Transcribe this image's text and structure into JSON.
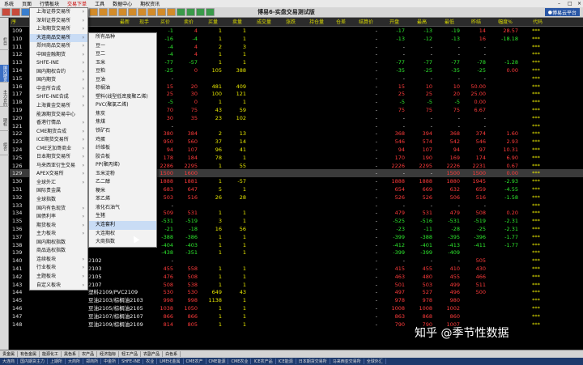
{
  "menubar": {
    "items": [
      "系统",
      "页面",
      "行情板块",
      "交易下单",
      "工具",
      "数据中心",
      "期权资讯"
    ],
    "active_index": 3
  },
  "titlebar": {
    "app_title": "博易6-实盘交易测试版",
    "user": "博易云平台"
  },
  "toolbar": {
    "button_colors": [
      "#c94a3b",
      "#c94a3b",
      "#3a7fcf",
      "#3a7fcf",
      "#3a7fcf",
      "#7a7a7a",
      "#7a7a7a",
      "#d28b2a",
      "#d28b2a",
      "#d28b2a",
      "#d28b2a",
      "#d28b2a",
      "#d28b2a",
      "#d28b2a",
      "#d28b2a",
      "#d28b2a",
      "#d28b2a",
      "#d28b2a",
      "#3a9a4a",
      "#3a9a4a",
      "#3a9a4a",
      "#3a9a4a"
    ]
  },
  "sidebar": {
    "tabs": [
      "栏目",
      "国内期货",
      "主力合约",
      "期权",
      "组合"
    ],
    "active_index": 1
  },
  "table": {
    "columns": [
      "序",
      "代码",
      "名称",
      "最新",
      "现手",
      "买价",
      "卖价",
      "买量",
      "卖量",
      "成交量",
      "涨跌",
      "持仓量",
      "仓差",
      "结算价",
      "开盘",
      "最高",
      "最低",
      "昨结",
      "幅度%",
      "代码"
    ],
    "rows": [
      {
        "no": "109",
        "name": "",
        "c5": "-1",
        "c6": "4",
        "c7": "1",
        "c8": "1",
        "c13": "-",
        "c14": "-17",
        "c15": "-13",
        "c16": "-19",
        "c17": "14",
        "c18": "28.57",
        "code": "***"
      },
      {
        "no": "110",
        "name": "",
        "c5": "-16",
        "c6": "-4",
        "c7": "1",
        "c8": "1",
        "c13": "-",
        "c14": "-13",
        "c15": "-12",
        "c16": "-13",
        "c17": "16",
        "c18": "-18.18",
        "code": "***"
      },
      {
        "no": "111",
        "name": "",
        "c5": "-4",
        "c6": "4",
        "c7": "2",
        "c8": "3",
        "c13": "-",
        "c14": "-",
        "c15": "-",
        "c16": "-",
        "c17": "-",
        "c18": "",
        "code": "***"
      },
      {
        "no": "112",
        "name": "",
        "c5": "-4",
        "c6": "4",
        "c7": "1",
        "c8": "1",
        "c13": "-",
        "c14": "-",
        "c15": "-",
        "c16": "-",
        "c17": "-",
        "c18": "",
        "code": "***"
      },
      {
        "no": "113",
        "name": "",
        "c5": "-77",
        "c6": "-57",
        "c7": "1",
        "c8": "1",
        "c13": "-",
        "c14": "-77",
        "c15": "-77",
        "c16": "-77",
        "c17": "-78",
        "c18": "-1.28",
        "code": "***"
      },
      {
        "no": "114",
        "name": "",
        "c5": "-25",
        "c6": "0",
        "c7": "105",
        "c8": "388",
        "c13": "-",
        "c14": "-35",
        "c15": "-25",
        "c16": "-35",
        "c17": "-25",
        "c18": "0.00",
        "code": "***"
      },
      {
        "no": "115",
        "name": "",
        "c5": "-",
        "c6": "",
        "c7": "",
        "c8": "",
        "c13": "-",
        "c14": "-",
        "c15": "-",
        "c16": "-",
        "c17": "-",
        "c18": "",
        "code": "***"
      },
      {
        "no": "116",
        "name": "",
        "c5": "15",
        "c6": "20",
        "c7": "481",
        "c8": "409",
        "c13": "-",
        "c14": "15",
        "c15": "10",
        "c16": "10",
        "c17": "50.00",
        "c18": "",
        "code": "***"
      },
      {
        "no": "117",
        "name": "",
        "c5": "25",
        "c6": "30",
        "c7": "100",
        "c8": "121",
        "c13": "-",
        "c14": "25",
        "c15": "25",
        "c16": "20",
        "c17": "25.00",
        "c18": "",
        "code": "***"
      },
      {
        "no": "118",
        "name": "",
        "c5": "-5",
        "c6": "0",
        "c7": "1",
        "c8": "1",
        "c13": "-",
        "c14": "-5",
        "c15": "-5",
        "c16": "-5",
        "c17": "0.00",
        "c18": "",
        "code": "***"
      },
      {
        "no": "119",
        "name": "",
        "c5": "70",
        "c6": "75",
        "c7": "43",
        "c8": "59",
        "c13": "-",
        "c14": "75",
        "c15": "75",
        "c16": "75",
        "c17": "6.67",
        "c18": "",
        "code": "***"
      },
      {
        "no": "120",
        "name": "",
        "c5": "30",
        "c6": "35",
        "c7": "23",
        "c8": "102",
        "c13": "-",
        "c14": "-",
        "c15": "-",
        "c16": "-",
        "c17": "-",
        "c18": "",
        "code": "***"
      },
      {
        "no": "121",
        "name": "",
        "c5": "-",
        "c6": "",
        "c7": "",
        "c8": "",
        "c13": "-",
        "c14": "-",
        "c15": "-",
        "c16": "-",
        "c17": "-",
        "c18": "",
        "code": "***"
      },
      {
        "no": "122",
        "name": "",
        "c5": "380",
        "c6": "384",
        "c7": "2",
        "c8": "13",
        "c13": "-",
        "c14": "368",
        "c15": "394",
        "c16": "368",
        "c17": "374",
        "c18": "1.60",
        "code": "***"
      },
      {
        "no": "123",
        "name": "",
        "c5": "950",
        "c6": "560",
        "c7": "37",
        "c8": "14",
        "c13": "-",
        "c14": "546",
        "c15": "574",
        "c16": "542",
        "c17": "546",
        "c18": "2.93",
        "code": "***"
      },
      {
        "no": "124",
        "name": "",
        "c5": "94",
        "c6": "107",
        "c7": "96",
        "c8": "41",
        "c13": "-",
        "c14": "94",
        "c15": "107",
        "c16": "94",
        "c17": "97",
        "c18": "10.31",
        "code": "***"
      },
      {
        "no": "125",
        "name": "",
        "c5": "178",
        "c6": "184",
        "c7": "78",
        "c8": "1",
        "c13": "-",
        "c14": "170",
        "c15": "190",
        "c16": "169",
        "c17": "174",
        "c18": "6.90",
        "code": "***"
      },
      {
        "no": "126",
        "name": "",
        "c5": "2286",
        "c6": "2295",
        "c7": "1",
        "c8": "55",
        "c13": "-",
        "c14": "2226",
        "c15": "2295",
        "c16": "2226",
        "c17": "2231",
        "c18": "0.67",
        "code": "***"
      },
      {
        "no": "129",
        "name": "",
        "c5": "1500",
        "c6": "1600",
        "c7": "",
        "c8": "",
        "c13": "-",
        "c14": "-",
        "c15": "-",
        "c16": "1500",
        "c17": "1500",
        "c18": "0.00",
        "code": "***"
      },
      {
        "no": "130",
        "name": "",
        "c5": "1888",
        "c6": "1881",
        "c7": "1",
        "c8": "-57",
        "c13": "-",
        "c14": "1888",
        "c15": "1888",
        "c16": "1880",
        "c17": "1945",
        "c18": "-2.93",
        "code": "***"
      },
      {
        "no": "131",
        "name": "",
        "c5": "683",
        "c6": "647",
        "c7": "5",
        "c8": "1",
        "c13": "-",
        "c14": "654",
        "c15": "669",
        "c16": "632",
        "c17": "659",
        "c18": "-4.55",
        "code": "***"
      },
      {
        "no": "132",
        "name": "",
        "c5": "503",
        "c6": "516",
        "c7": "26",
        "c8": "28",
        "c13": "-",
        "c14": "526",
        "c15": "526",
        "c16": "506",
        "c17": "516",
        "c18": "-1.58",
        "code": "***"
      },
      {
        "no": "133",
        "name": "",
        "c5": "-",
        "c6": "",
        "c7": "",
        "c8": "",
        "c13": "-",
        "c14": "-",
        "c15": "-",
        "c16": "-",
        "c17": "-",
        "c18": "",
        "code": "***"
      },
      {
        "no": "134",
        "name": "",
        "c5": "509",
        "c6": "531",
        "c7": "1",
        "c8": "1",
        "c13": "-",
        "c14": "479",
        "c15": "531",
        "c16": "479",
        "c17": "508",
        "c18": "0.20",
        "code": "***"
      },
      {
        "no": "135",
        "name": "",
        "c5": "-531",
        "c6": "-519",
        "c7": "3",
        "c8": "1",
        "c13": "-",
        "c14": "-525",
        "c15": "-516",
        "c16": "-531",
        "c17": "-519",
        "c18": "-2.31",
        "code": "***"
      },
      {
        "no": "136",
        "name": "",
        "c5": "-21",
        "c6": "-18",
        "c7": "16",
        "c8": "56",
        "c13": "-",
        "c14": "-23",
        "c15": "-11",
        "c16": "-28",
        "c17": "-25",
        "c18": "-2.31",
        "code": "***"
      },
      {
        "no": "137",
        "name": "",
        "c5": "-388",
        "c6": "-386",
        "c7": "1",
        "c8": "1",
        "c13": "-",
        "c14": "-399",
        "c15": "-388",
        "c16": "-395",
        "c17": "-396",
        "c18": "-1.77",
        "code": "***"
      },
      {
        "no": "138",
        "name": "",
        "c5": "-404",
        "c6": "-403",
        "c7": "1",
        "c8": "1",
        "c13": "-",
        "c14": "-412",
        "c15": "-401",
        "c16": "-413",
        "c17": "-411",
        "c18": "-1.77",
        "code": "***"
      },
      {
        "no": "139",
        "name": "",
        "c5": "-438",
        "c6": "-351",
        "c7": "1",
        "c8": "1",
        "c13": "-",
        "c14": "-399",
        "c15": "-399",
        "c16": "-409",
        "c17": "",
        "c18": "",
        "code": "***"
      },
      {
        "no": "140",
        "name": "2102",
        "c5": "-",
        "c6": "",
        "c7": "",
        "c8": "",
        "c13": "-",
        "c14": "-",
        "c15": "-",
        "c16": "-",
        "c17": "505",
        "c18": "",
        "code": "***"
      },
      {
        "no": "141",
        "name": "2103",
        "c5": "455",
        "c6": "558",
        "c7": "1",
        "c8": "1",
        "c13": "-",
        "c14": "415",
        "c15": "455",
        "c16": "410",
        "c17": "430",
        "c18": "",
        "code": "***"
      },
      {
        "no": "142",
        "name": "2105",
        "c5": "476",
        "c6": "508",
        "c7": "1",
        "c8": "1",
        "c13": "-",
        "c14": "463",
        "c15": "480",
        "c16": "455",
        "c17": "466",
        "c18": "",
        "code": "***"
      },
      {
        "no": "143",
        "name": "2107",
        "c5": "508",
        "c6": "538",
        "c7": "1",
        "c8": "1",
        "c13": "-",
        "c14": "501",
        "c15": "503",
        "c16": "499",
        "c17": "511",
        "c18": "",
        "code": "***"
      },
      {
        "no": "144",
        "name": "塑料2109/PVC2109",
        "c5": "530",
        "c6": "530",
        "c7": "649",
        "c8": "43",
        "c13": "-",
        "c14": "497",
        "c15": "527",
        "c16": "496",
        "c17": "500",
        "c18": "",
        "code": "***"
      },
      {
        "no": "145",
        "name": "豆油2103/棕榈油2103",
        "c5": "998",
        "c6": "998",
        "c7": "1138",
        "c8": "1",
        "c13": "-",
        "c14": "978",
        "c15": "978",
        "c16": "980",
        "c17": "",
        "c18": "",
        "code": "***"
      },
      {
        "no": "146",
        "name": "豆油2105/棕榈油2105",
        "c5": "1038",
        "c6": "1050",
        "c7": "1",
        "c8": "1",
        "c13": "-",
        "c14": "1008",
        "c15": "1008",
        "c16": "1002",
        "c17": "",
        "c18": "",
        "code": "***"
      },
      {
        "no": "147",
        "name": "豆油2107/棕榈油2107",
        "c5": "866",
        "c6": "866",
        "c7": "1",
        "c8": "1",
        "c13": "-",
        "c14": "863",
        "c15": "868",
        "c16": "860",
        "c17": "",
        "c18": "",
        "code": "***"
      },
      {
        "no": "148",
        "name": "豆油2109/棕榈油2109",
        "c5": "814",
        "c6": "805",
        "c7": "1",
        "c8": "1",
        "c13": "-",
        "c14": "790",
        "c15": "790",
        "c16": "1007",
        "c17": "",
        "c18": "",
        "code": "***"
      }
    ]
  },
  "menu1": {
    "items": [
      {
        "label": "上海证券交易所",
        "arrow": true
      },
      {
        "label": "深圳证券交易所",
        "arrow": true
      },
      {
        "label": "上海期货交易所",
        "arrow": true
      },
      {
        "label": "大连商品交易所",
        "arrow": true,
        "hl": true
      },
      {
        "label": "郑州商品交易所",
        "arrow": true
      },
      {
        "label": "中国金融期货",
        "arrow": true
      },
      {
        "label": "SHFE-INE",
        "arrow": true
      },
      {
        "label": "国内期权合约",
        "arrow": true
      },
      {
        "label": "国内期货",
        "arrow": true
      },
      {
        "label": "中金所合成",
        "arrow": true
      },
      {
        "label": "SHFE-INE合成",
        "arrow": true
      },
      {
        "label": "上海黄金交易所",
        "arrow": true
      },
      {
        "label": "能源期货交易中心",
        "arrow": false
      },
      {
        "label": "香港行情品",
        "arrow": true
      },
      {
        "label": "CME期货合成",
        "arrow": true
      },
      {
        "label": "ICE期货交易所",
        "arrow": true
      },
      {
        "label": "CME芝加哥商业",
        "arrow": true
      },
      {
        "label": "日本期货交易所",
        "arrow": true
      },
      {
        "label": "马来西亚衍生交易",
        "arrow": true
      },
      {
        "label": "APEX交易所",
        "arrow": true
      },
      {
        "label": "全球外汇",
        "arrow": true
      },
      {
        "label": "国际贵金属",
        "arrow": false
      },
      {
        "label": "全球指数",
        "arrow": false
      },
      {
        "label": "国内有色现货",
        "arrow": true
      },
      {
        "label": "国债利率",
        "arrow": true
      },
      {
        "label": "期货板块",
        "arrow": true
      },
      {
        "label": "主力板块",
        "arrow": true
      },
      {
        "label": "国内期权指数",
        "arrow": false
      },
      {
        "label": "商品选权指数",
        "arrow": false
      },
      {
        "label": "连续板块",
        "arrow": true
      },
      {
        "label": "行业板块",
        "arrow": true
      },
      {
        "label": "主题板块",
        "arrow": true
      },
      {
        "label": "自定义板块",
        "arrow": true
      }
    ]
  },
  "menu2": {
    "items": [
      {
        "label": "所有品种"
      },
      {
        "label": "豆一"
      },
      {
        "label": "豆二"
      },
      {
        "label": "玉米"
      },
      {
        "label": "豆粕"
      },
      {
        "label": "豆油"
      },
      {
        "label": "棕榈油"
      },
      {
        "label": "塑料(线型低密度聚乙烯)"
      },
      {
        "label": "PVC(聚氯乙烯)"
      },
      {
        "label": "焦炭"
      },
      {
        "label": "焦煤"
      },
      {
        "label": "铁矿石"
      },
      {
        "label": "鸡蛋"
      },
      {
        "label": "纤维板"
      },
      {
        "label": "胶合板"
      },
      {
        "label": "PP(聚丙烯)"
      },
      {
        "label": "玉米淀粉"
      },
      {
        "label": "乙二醇"
      },
      {
        "label": "粳米"
      },
      {
        "label": "苯乙烯"
      },
      {
        "label": "液化石油气"
      },
      {
        "label": "生猪"
      },
      {
        "label": "大连套利",
        "hl": true
      },
      {
        "label": "大连期权"
      },
      {
        "label": "大商指数"
      }
    ]
  },
  "bottom_tabs": [
    "贵金属",
    "有色金属",
    "能源化工",
    "黑色系",
    "农产品",
    "经济指标",
    "轻工产品",
    "农副产品",
    "白色系"
  ],
  "status_items": [
    "大连商",
    "国内期货主力",
    "上期所",
    "大商所",
    "郑商所",
    "中金所",
    "SHFE-INE",
    "农业",
    "LME化金属",
    "CME农产",
    "CME能源",
    "CME农业",
    "ICE农产品",
    "ICE能源",
    "日本期货交易所",
    "马来西亚交易所",
    "全球外汇"
  ],
  "watermark": "知乎 @季节性数据",
  "colors": {
    "up": "#ff3b3b",
    "down": "#2ee82e",
    "neutral": "#e0e0e0",
    "header": "#d8d800",
    "code": "#e6e600",
    "number": "#e8e8e8"
  }
}
